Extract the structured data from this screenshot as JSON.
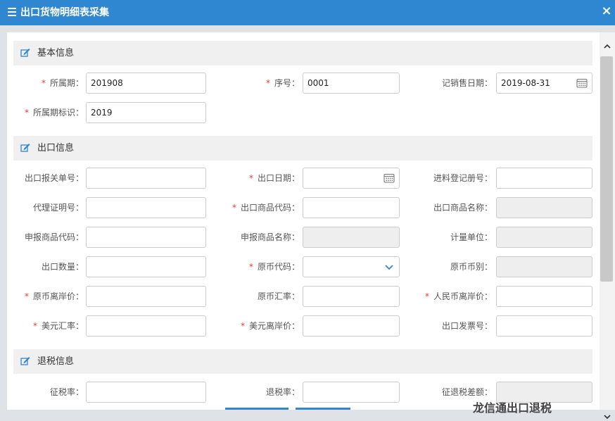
{
  "window": {
    "title": "出口货物明细表采集",
    "close_glyph": "×"
  },
  "sections": {
    "basic": "基本信息",
    "export": "出口信息",
    "refund": "退税信息"
  },
  "fields": {
    "period": {
      "label": "所属期：",
      "value": "201908",
      "required": true
    },
    "seq_no": {
      "label": "序号：",
      "value": "0001",
      "required": true
    },
    "sales_date": {
      "label": "记销售日期：",
      "value": "2019-08-31",
      "required": false
    },
    "period_flag": {
      "label": "所属期标识：",
      "value": "2019",
      "required": true
    },
    "customs_no": {
      "label": "出口报关单号：",
      "value": ""
    },
    "export_date": {
      "label": "出口日期：",
      "value": "",
      "required": true
    },
    "import_reg_no": {
      "label": "进料登记册号：",
      "value": ""
    },
    "agency_cert_no": {
      "label": "代理证明号：",
      "value": ""
    },
    "goods_code": {
      "label": "出口商品代码：",
      "value": "",
      "required": true
    },
    "goods_name": {
      "label": "出口商品名称：",
      "value": ""
    },
    "decl_goods_code": {
      "label": "申报商品代码：",
      "value": ""
    },
    "decl_goods_name": {
      "label": "申报商品名称：",
      "value": ""
    },
    "unit": {
      "label": "计量单位：",
      "value": ""
    },
    "quantity": {
      "label": "出口数量：",
      "value": ""
    },
    "currency_code": {
      "label": "原币代码：",
      "value": "",
      "required": true
    },
    "currency": {
      "label": "原币币别：",
      "value": ""
    },
    "fob_orig": {
      "label": "原币离岸价：",
      "value": "",
      "required": true
    },
    "orig_rate": {
      "label": "原币汇率：",
      "value": ""
    },
    "fob_rmb": {
      "label": "人民币离岸价：",
      "value": "",
      "required": true
    },
    "usd_rate": {
      "label": "美元汇率：",
      "value": "",
      "required": true
    },
    "fob_usd": {
      "label": "美元离岸价：",
      "value": "",
      "required": true
    },
    "invoice_no": {
      "label": "出口发票号：",
      "value": ""
    },
    "tax_rate": {
      "label": "征税率：",
      "value": ""
    },
    "refund_rate": {
      "label": "退税率：",
      "value": ""
    },
    "tax_refund_diff": {
      "label": "征退税差额：",
      "value": ""
    }
  },
  "required_mark": "*",
  "watermark": "龙信通出口退税",
  "colors": {
    "accent": "#2f86d1",
    "required": "#e0393e",
    "section_bg": "#f0f0f0",
    "disabled_bg": "#eeeeee"
  }
}
